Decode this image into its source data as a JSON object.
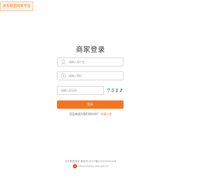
{
  "header": {
    "badge_text": "京东联盟商家平台"
  },
  "login": {
    "title": "商家登录",
    "username_placeholder": "请输入用户名",
    "password_placeholder": "请输入密码",
    "captcha_placeholder": "请输入验证码",
    "captcha_chars": [
      "7",
      "5",
      "1",
      "1"
    ],
    "submit_label": "登录",
    "apply_text": "还没有成为我们的伙伴？",
    "apply_link": "申请入驻"
  },
  "footer": {
    "line1": "京东联盟商家 备案号:京ICP备2020000000号",
    "line2": "https://beian.miit.gov.cn"
  },
  "colors": {
    "accent": "#f5741f",
    "border": "#d9d9d9"
  }
}
